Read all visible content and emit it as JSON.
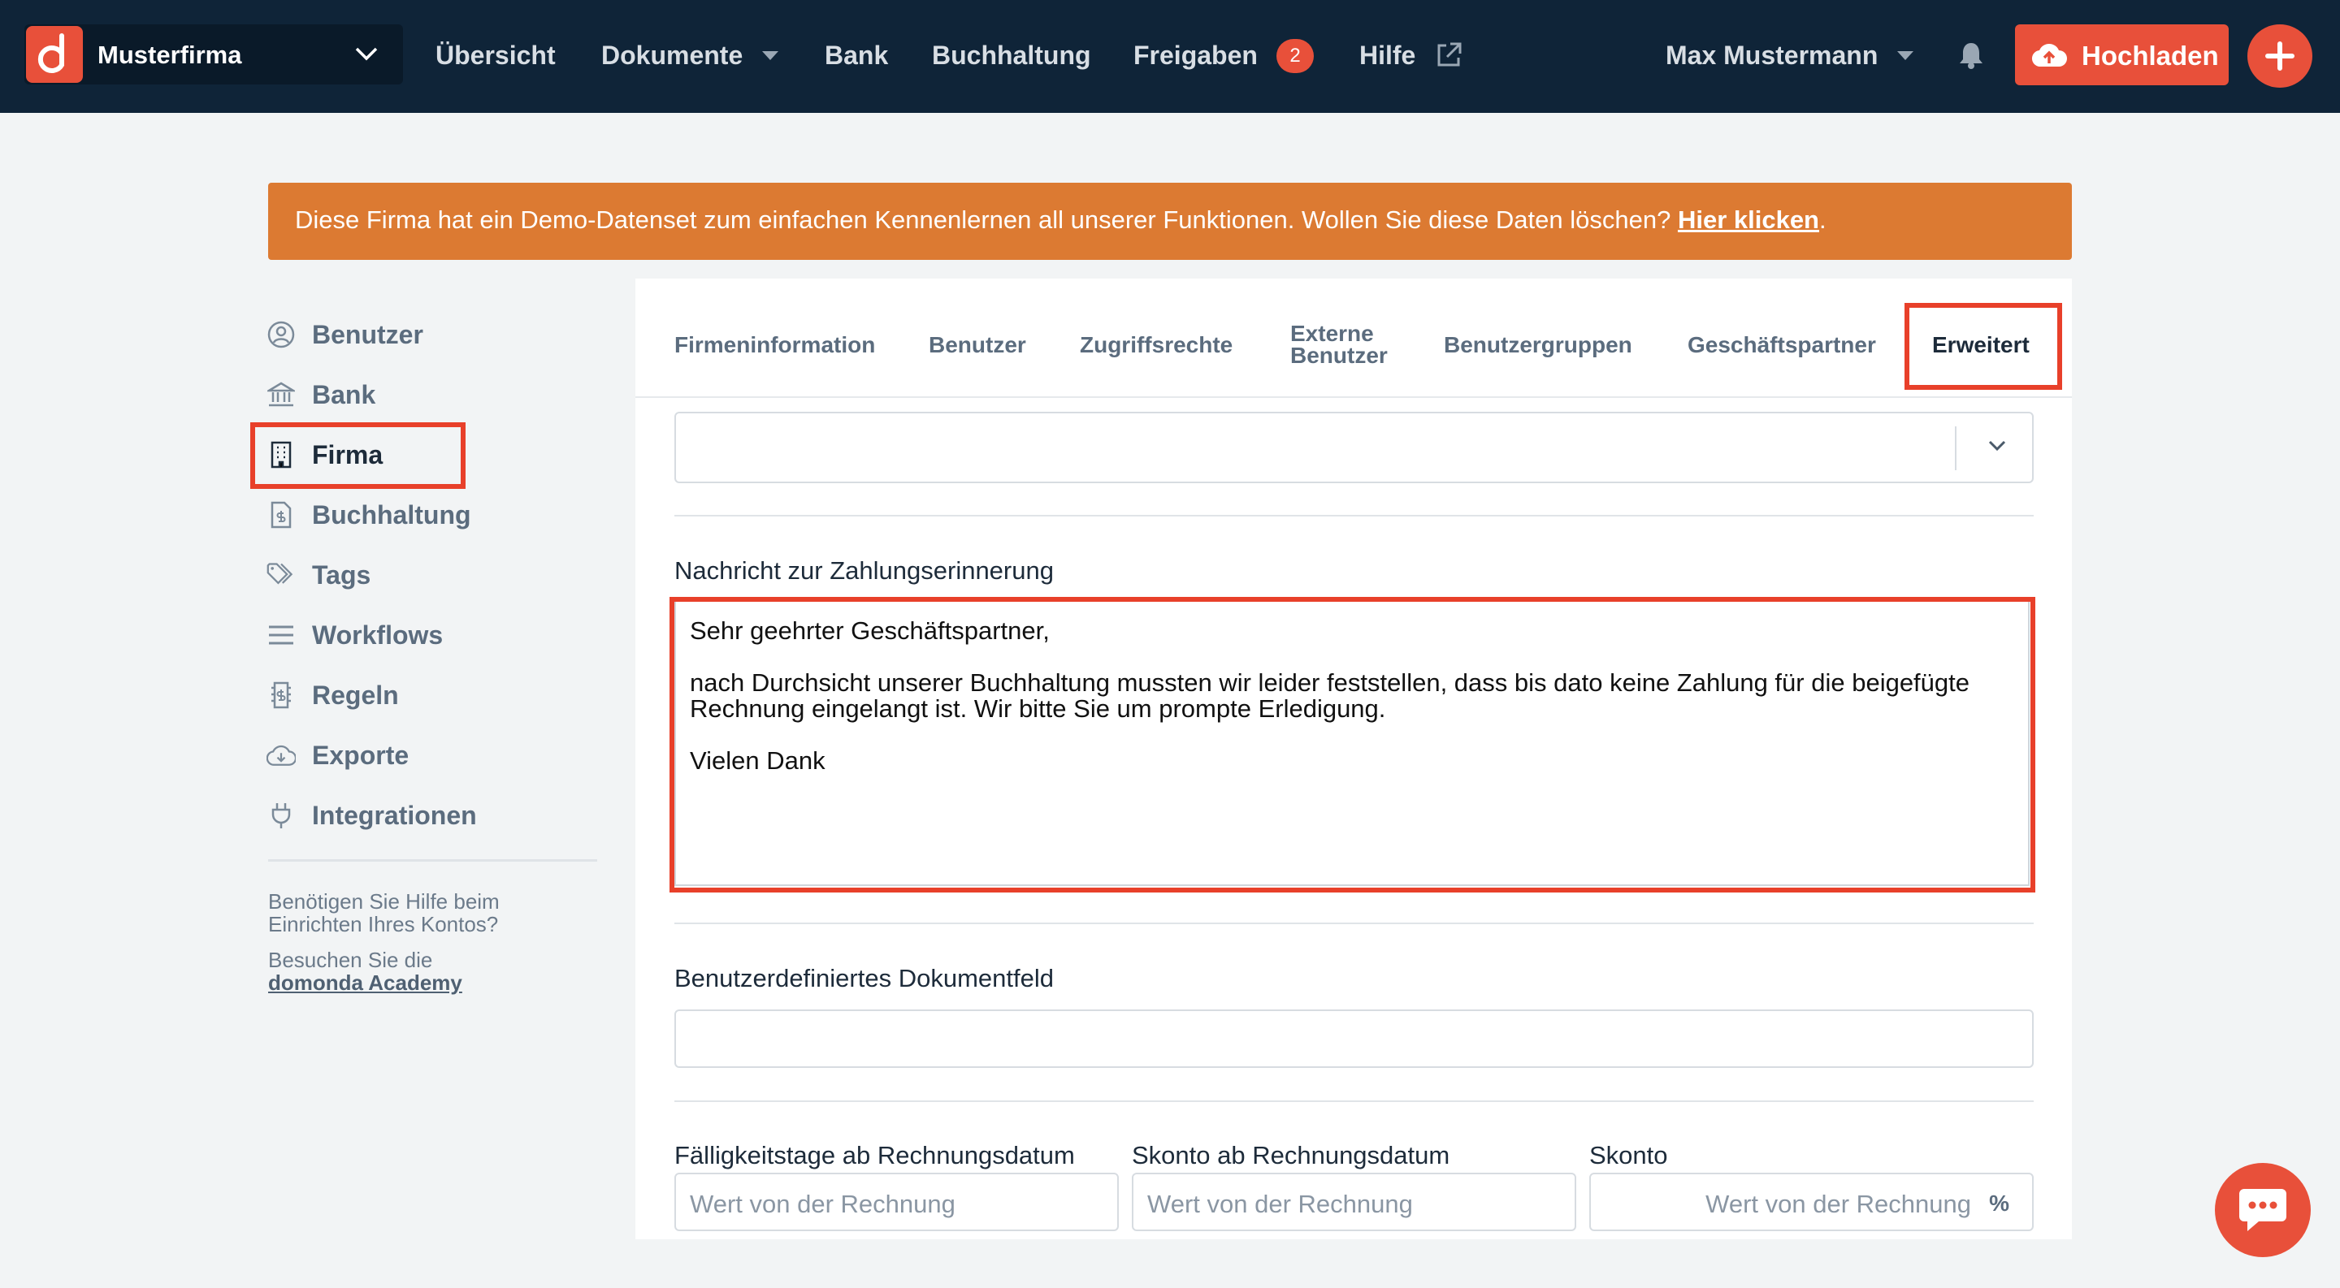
{
  "topbar": {
    "company_name": "Musterfirma",
    "nav": [
      {
        "label": "Übersicht"
      },
      {
        "label": "Dokumente"
      },
      {
        "label": "Bank"
      },
      {
        "label": "Buchhaltung"
      },
      {
        "label": "Freigaben"
      },
      {
        "label": "Hilfe"
      }
    ],
    "freigaben_badge": "2",
    "user_name": "Max Mustermann",
    "upload_label": "Hochladen"
  },
  "banner": {
    "text": "Diese Firma hat ein Demo-Datenset zum einfachen Kennenlernen all unserer Funktionen. Wollen Sie diese Daten löschen?",
    "link": "Hier klicken",
    "suffix": "."
  },
  "sidebar": {
    "items": [
      {
        "label": "Benutzer",
        "icon": "user-circle-icon"
      },
      {
        "label": "Bank",
        "icon": "bank-icon"
      },
      {
        "label": "Firma",
        "icon": "building-icon"
      },
      {
        "label": "Buchhaltung",
        "icon": "accounting-file-icon"
      },
      {
        "label": "Tags",
        "icon": "tags-icon"
      },
      {
        "label": "Workflows",
        "icon": "list-icon"
      },
      {
        "label": "Regeln",
        "icon": "rules-icon"
      },
      {
        "label": "Exporte",
        "icon": "cloud-download-icon"
      },
      {
        "label": "Integrationen",
        "icon": "plug-icon"
      }
    ],
    "active": "Firma",
    "help_text": "Benötigen Sie Hilfe beim Einrichten Ihres Kontos?",
    "academy_prefix": "Besuchen Sie die",
    "academy_link": "domonda Academy"
  },
  "tabs": [
    {
      "label": "Firmeninformation"
    },
    {
      "label": "Benutzer"
    },
    {
      "label": "Zugriffsrechte"
    },
    {
      "label": "Externe\nBenutzer"
    },
    {
      "label": "Benutzergruppen"
    },
    {
      "label": "Geschäftspartner"
    },
    {
      "label": "Erweitert"
    }
  ],
  "active_tab": "Erweitert",
  "form": {
    "select_value": "",
    "reminder_label": "Nachricht zur Zahlungserinnerung",
    "reminder_text": "Sehr geehrter Geschäftspartner,\n\nnach Durchsicht unserer Buchhaltung mussten wir leider feststellen, dass bis dato keine Zahlung für die beigefügte Rechnung eingelangt ist. Wir bitte Sie um prompte Erledigung.\n\nVielen Dank",
    "custom_field_label": "Benutzerdefiniertes Dokumentfeld",
    "custom_field_value": "",
    "due_days_label": "Fälligkeitstage ab Rechnungsdatum",
    "due_days_placeholder": "Wert von der Rechnung",
    "skonto_days_label": "Skonto ab Rechnungsdatum",
    "skonto_days_placeholder": "Wert von der Rechnung",
    "skonto_label": "Skonto",
    "skonto_placeholder": "Wert von der Rechnung",
    "skonto_unit": "%"
  },
  "colors": {
    "nav_bg": "#0f2438",
    "accent": "#e8503a",
    "banner": "#dc7a32",
    "highlight": "#e8402a"
  }
}
